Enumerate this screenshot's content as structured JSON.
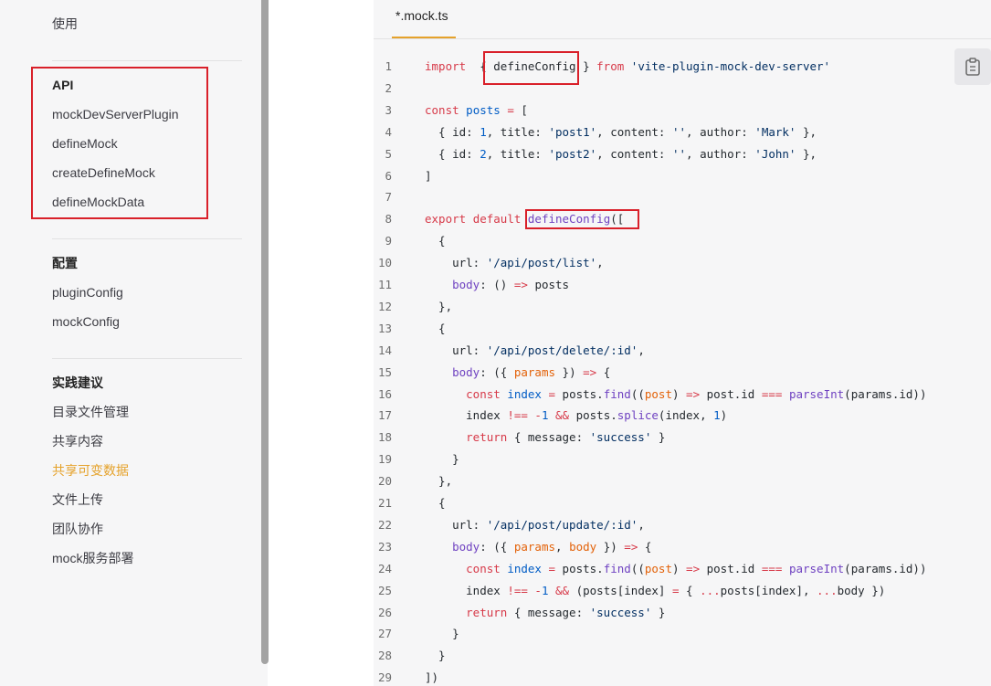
{
  "sidebar": {
    "prev_item": "使用",
    "groups": [
      {
        "title": "API",
        "items": [
          "mockDevServerPlugin",
          "defineMock",
          "createDefineMock",
          "defineMockData"
        ]
      },
      {
        "title": "配置",
        "items": [
          "pluginConfig",
          "mockConfig"
        ]
      },
      {
        "title": "实践建议",
        "items": [
          "目录文件管理",
          "共享内容",
          "共享可变数据",
          "文件上传",
          "团队协作",
          "mock服务部署"
        ]
      }
    ],
    "active_item": "共享可变数据"
  },
  "code": {
    "tab_label": "*.mock.ts",
    "copy_icon": "clipboard-icon",
    "line_numbers": [
      "1",
      "2",
      "3",
      "4",
      "5",
      "6",
      "7",
      "8",
      "9",
      "10",
      "11",
      "12",
      "13",
      "14",
      "15",
      "16",
      "17",
      "18",
      "19",
      "20",
      "21",
      "22",
      "23",
      "24",
      "25",
      "26",
      "27",
      "28",
      "29"
    ],
    "lines": [
      [
        [
          "k",
          "import"
        ],
        [
          "",
          "  { "
        ],
        [
          "",
          "defineConfig"
        ],
        [
          "",
          " } "
        ],
        [
          "k",
          "from"
        ],
        [
          "",
          " "
        ],
        [
          "s",
          "'vite-plugin-mock-dev-server'"
        ]
      ],
      [],
      [
        [
          "k",
          "const"
        ],
        [
          "",
          ""
        ],
        [
          "n",
          " posts"
        ],
        [
          "",
          " "
        ],
        [
          "k",
          "="
        ],
        [
          "",
          " ["
        ]
      ],
      [
        [
          "",
          "  { id: "
        ],
        [
          "n",
          "1"
        ],
        [
          "",
          ", title: "
        ],
        [
          "s",
          "'post1'"
        ],
        [
          "",
          ", content: "
        ],
        [
          "s",
          "''"
        ],
        [
          "",
          ", author: "
        ],
        [
          "s",
          "'Mark'"
        ],
        [
          "",
          " },"
        ]
      ],
      [
        [
          "",
          "  { id: "
        ],
        [
          "n",
          "2"
        ],
        [
          "",
          ", title: "
        ],
        [
          "s",
          "'post2'"
        ],
        [
          "",
          ", content: "
        ],
        [
          "s",
          "''"
        ],
        [
          "",
          ", author: "
        ],
        [
          "s",
          "'John'"
        ],
        [
          "",
          " },"
        ]
      ],
      [
        [
          "",
          "]"
        ]
      ],
      [],
      [
        [
          "k",
          "export"
        ],
        [
          "",
          " "
        ],
        [
          "k",
          "default"
        ],
        [
          "",
          " "
        ],
        [
          "f",
          "defineConfig"
        ],
        [
          "",
          "(["
        ]
      ],
      [
        [
          "",
          "  {"
        ]
      ],
      [
        [
          "",
          "    url: "
        ],
        [
          "s",
          "'/api/post/list'"
        ],
        [
          "",
          ","
        ]
      ],
      [
        [
          "f",
          "    body"
        ],
        [
          "",
          ": () "
        ],
        [
          "k",
          "=>"
        ],
        [
          "",
          " posts"
        ]
      ],
      [
        [
          "",
          "  },"
        ]
      ],
      [
        [
          "",
          "  {"
        ]
      ],
      [
        [
          "",
          "    url: "
        ],
        [
          "s",
          "'/api/post/delete/:id'"
        ],
        [
          "",
          ","
        ]
      ],
      [
        [
          "f",
          "    body"
        ],
        [
          "",
          ": ({ "
        ],
        [
          "p",
          "params"
        ],
        [
          "",
          " }) "
        ],
        [
          "k",
          "=>"
        ],
        [
          "",
          " {"
        ]
      ],
      [
        [
          "k",
          "      const"
        ],
        [
          "n",
          " index"
        ],
        [
          "",
          " "
        ],
        [
          "k",
          "="
        ],
        [
          "",
          " posts."
        ],
        [
          "f",
          "find"
        ],
        [
          "",
          "(("
        ],
        [
          "p",
          "post"
        ],
        [
          "",
          ") "
        ],
        [
          "k",
          "=>"
        ],
        [
          "",
          " post.id "
        ],
        [
          "k",
          "==="
        ],
        [
          "",
          " "
        ],
        [
          "f",
          "parseInt"
        ],
        [
          "",
          "(params.id))"
        ]
      ],
      [
        [
          "",
          "      index "
        ],
        [
          "k",
          "!=="
        ],
        [
          "",
          " "
        ],
        [
          "k",
          "-"
        ],
        [
          "n",
          "1"
        ],
        [
          "",
          " "
        ],
        [
          "k",
          "&&"
        ],
        [
          "",
          " posts."
        ],
        [
          "f",
          "splice"
        ],
        [
          "",
          "(index, "
        ],
        [
          "n",
          "1"
        ],
        [
          "",
          ")"
        ]
      ],
      [
        [
          "k",
          "      return"
        ],
        [
          "",
          " { message: "
        ],
        [
          "s",
          "'success'"
        ],
        [
          "",
          " }"
        ]
      ],
      [
        [
          "",
          "    }"
        ]
      ],
      [
        [
          "",
          "  },"
        ]
      ],
      [
        [
          "",
          "  {"
        ]
      ],
      [
        [
          "",
          "    url: "
        ],
        [
          "s",
          "'/api/post/update/:id'"
        ],
        [
          "",
          ","
        ]
      ],
      [
        [
          "f",
          "    body"
        ],
        [
          "",
          ": ({ "
        ],
        [
          "p",
          "params"
        ],
        [
          "",
          ", "
        ],
        [
          "p",
          "body"
        ],
        [
          "",
          " }) "
        ],
        [
          "k",
          "=>"
        ],
        [
          "",
          " {"
        ]
      ],
      [
        [
          "k",
          "      const"
        ],
        [
          "n",
          " index"
        ],
        [
          "",
          " "
        ],
        [
          "k",
          "="
        ],
        [
          "",
          " posts."
        ],
        [
          "f",
          "find"
        ],
        [
          "",
          "(("
        ],
        [
          "p",
          "post"
        ],
        [
          "",
          ") "
        ],
        [
          "k",
          "=>"
        ],
        [
          "",
          " post.id "
        ],
        [
          "k",
          "==="
        ],
        [
          "",
          " "
        ],
        [
          "f",
          "parseInt"
        ],
        [
          "",
          "(params.id))"
        ]
      ],
      [
        [
          "",
          "      index "
        ],
        [
          "k",
          "!=="
        ],
        [
          "",
          " "
        ],
        [
          "k",
          "-"
        ],
        [
          "n",
          "1"
        ],
        [
          "",
          " "
        ],
        [
          "k",
          "&&"
        ],
        [
          "",
          " (posts[index] "
        ],
        [
          "k",
          "="
        ],
        [
          "",
          " { "
        ],
        [
          "k",
          "..."
        ],
        [
          "",
          "posts[index], "
        ],
        [
          "k",
          "..."
        ],
        [
          "",
          "body })"
        ]
      ],
      [
        [
          "k",
          "      return"
        ],
        [
          "",
          " { message: "
        ],
        [
          "s",
          "'success'"
        ],
        [
          "",
          " }"
        ]
      ],
      [
        [
          "",
          "    }"
        ]
      ],
      [
        [
          "",
          "  }"
        ]
      ],
      [
        [
          "",
          "])"
        ]
      ]
    ]
  },
  "colors": {
    "accent": "#e5a22b",
    "highlight_box": "#d9202a"
  }
}
